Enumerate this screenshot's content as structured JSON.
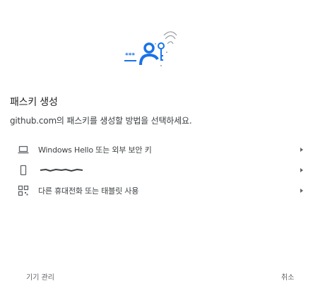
{
  "colors": {
    "accent": "#1a73e8",
    "text": "#202124",
    "muted": "#5f6368"
  },
  "hero": {
    "icon": "passkey-illustration"
  },
  "header": {
    "title": "패스키 생성",
    "subtitle": "github.com의 패스키를 생성할 방법을 선택하세요."
  },
  "options": [
    {
      "icon": "laptop-icon",
      "label": "Windows Hello 또는 외부 보안 키"
    },
    {
      "icon": "phone-icon",
      "label": ""
    },
    {
      "icon": "qr-code-icon",
      "label": "다른 휴대전화 또는 태블릿 사용"
    }
  ],
  "footer": {
    "left": "기기 관리",
    "right": "취소"
  }
}
